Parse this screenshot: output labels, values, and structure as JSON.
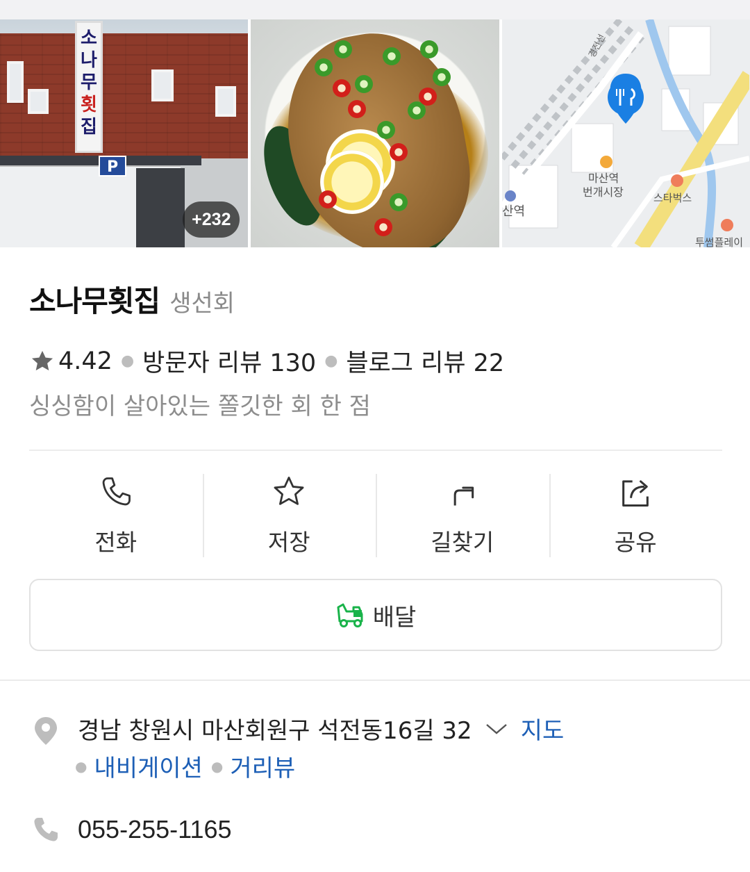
{
  "gallery": {
    "photo_count_badge": "+232",
    "building_sign": [
      "소",
      "나",
      "무",
      "횟",
      "집"
    ],
    "parking_sign": "P",
    "map_labels": {
      "station": "산역",
      "market_line1": "마산역",
      "market_line2": "번개시장",
      "starbucks": "스타벅스",
      "tousome": "투썸플레이",
      "railway": "경전선"
    }
  },
  "place": {
    "name": "소나무횟집",
    "category": "생선회",
    "rating": "4.42",
    "visitor_reviews": "방문자 리뷰 130",
    "blog_reviews": "블로그 리뷰 22",
    "tagline": "싱싱함이 살아있는 쫄깃한 회 한 점"
  },
  "actions": [
    {
      "label": "전화",
      "icon": "phone-icon"
    },
    {
      "label": "저장",
      "icon": "star-outline-icon"
    },
    {
      "label": "길찾기",
      "icon": "directions-icon"
    },
    {
      "label": "공유",
      "icon": "share-icon"
    }
  ],
  "delivery": {
    "label": "배달",
    "icon": "delivery-scooter-icon",
    "icon_color": "#19b34a"
  },
  "address": {
    "text": "경남 창원시 마산회원구 석전동16길 32",
    "map_link": "지도",
    "navigation_link": "내비게이션",
    "street_view_link": "거리뷰"
  },
  "phone": {
    "number": "055-255-1165"
  },
  "colors": {
    "link": "#1d5fb6",
    "muted_text": "#8d8d8d",
    "map_pin": "#1a7fe3",
    "road_yellow": "#f3df7d"
  }
}
